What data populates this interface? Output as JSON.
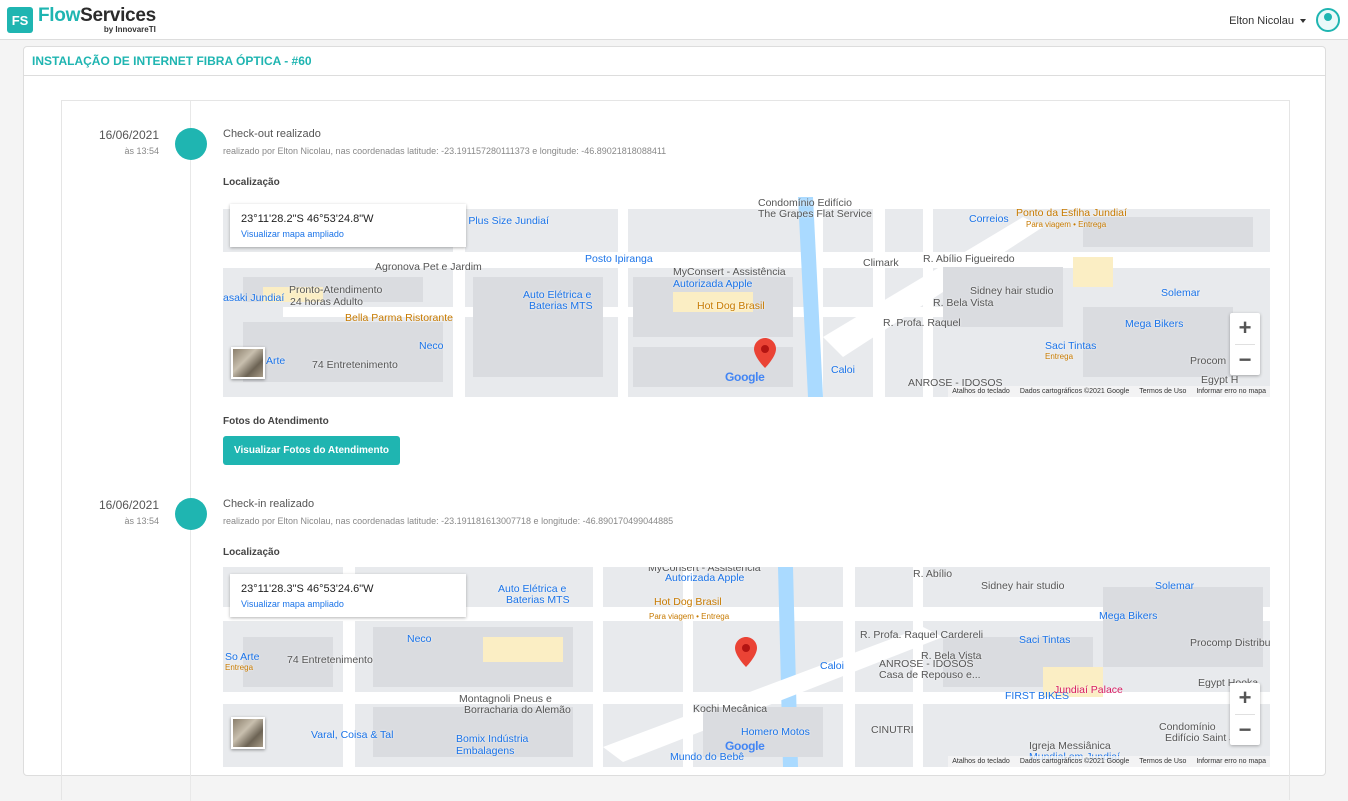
{
  "header": {
    "logo_mark": "FS",
    "app_name_part1": "Flow",
    "app_name_part2": "Services",
    "app_by": "by InnovareTI",
    "user_name": "Elton Nicolau"
  },
  "page": {
    "title": "INSTALAÇÃO DE INTERNET FIBRA ÓPTICA - #60"
  },
  "events": [
    {
      "date": "16/06/2021",
      "time": "às 13:54",
      "title": "Check-out realizado",
      "description": "realizado por Elton Nicolau, nas coordenadas latitude: -23.191157280111373 e longitude: -46.89021818088411",
      "location_label": "Localização",
      "map_coords": "23°11'28.2\"S 46°53'24.8\"W",
      "map_link": "Visualizar mapa ampliado",
      "photos_label": "Fotos do Atendimento",
      "photos_button": "Visualizar Fotos do Atendimento",
      "map_places": [
        "Condomínio Edifício",
        "The Grapes Flat Service",
        "Correios",
        "Ponto da Esfiha Jundiaí",
        "Para viagem • Entrega",
        "ards Plus Size Jundiaí",
        "Posto Ipiranga",
        "Climark",
        "R. Abílio Figueiredo",
        "Sidney hair studio",
        "Solemar",
        "asaki Jundiaí",
        "Agronova Pet e Jardim",
        "MyConsert - Assistência",
        "Autorizada Apple",
        "Pronto-Atendimento",
        "24 horas Adulto",
        "Auto Elétrica e",
        "Baterias MTS",
        "Hot Dog Brasil",
        "Bella Parma Ristorante",
        "Mega Bikers",
        "Saci Tintas",
        "Entrega",
        "Neco",
        "Arte",
        "74 Entretenimento",
        "Caloi",
        "R. Profa. Raquel",
        "R. Bela Vista",
        "Procom",
        "ANROSE - IDOSOS",
        "Egypt H"
      ]
    },
    {
      "date": "16/06/2021",
      "time": "às 13:54",
      "title": "Check-in realizado",
      "description": "realizado por Elton Nicolau, nas coordenadas latitude: -23.191181613007718 e longitude: -46.890170499044885",
      "location_label": "Localização",
      "map_coords": "23°11'28.3\"S 46°53'24.6\"W",
      "map_link": "Visualizar mapa ampliado",
      "map_places": [
        "MyConsert - Assistência",
        "Autorizada Apple",
        "R. Abílio",
        "Sidney hair studio",
        "Solemar",
        "Auto Elétrica e",
        "Baterias MTS",
        "Hot Dog Brasil",
        "Para viagem • Entrega",
        "Mega Bikers",
        "Neco",
        "So Arte",
        "Entrega",
        "74 Entretenimento",
        "Saci Tintas",
        "Procomp Distribuidor",
        "Caloi",
        "R. Profa. Raquel Cardereli",
        "R. Bela Vista",
        "ANROSE - IDOSOS",
        "Casa de Repouso e...",
        "FIRST BIKES",
        "Egypt Hooka",
        "Montagnoli Pneus e",
        "Borracharia do Alemão",
        "Jundiaí Palace",
        "Kochi Mecânica",
        "Varal, Coisa & Tal",
        "Bomix Indústria",
        "Embalagens",
        "Homero Motos",
        "Mundo do Bebê",
        "CINUTRI",
        "Igreja Messiânica",
        "Mundial em Jundiaí",
        "Condomínio",
        "Edifício Saint Ja"
      ]
    }
  ],
  "map_common": {
    "google": "Google",
    "attrib_keys": "Atalhos do teclado",
    "attrib_data": "Dados cartográficos ©2021 Google",
    "attrib_terms": "Termos de Uso",
    "attrib_report": "Informar erro no mapa",
    "zoom_in": "+",
    "zoom_out": "−"
  }
}
